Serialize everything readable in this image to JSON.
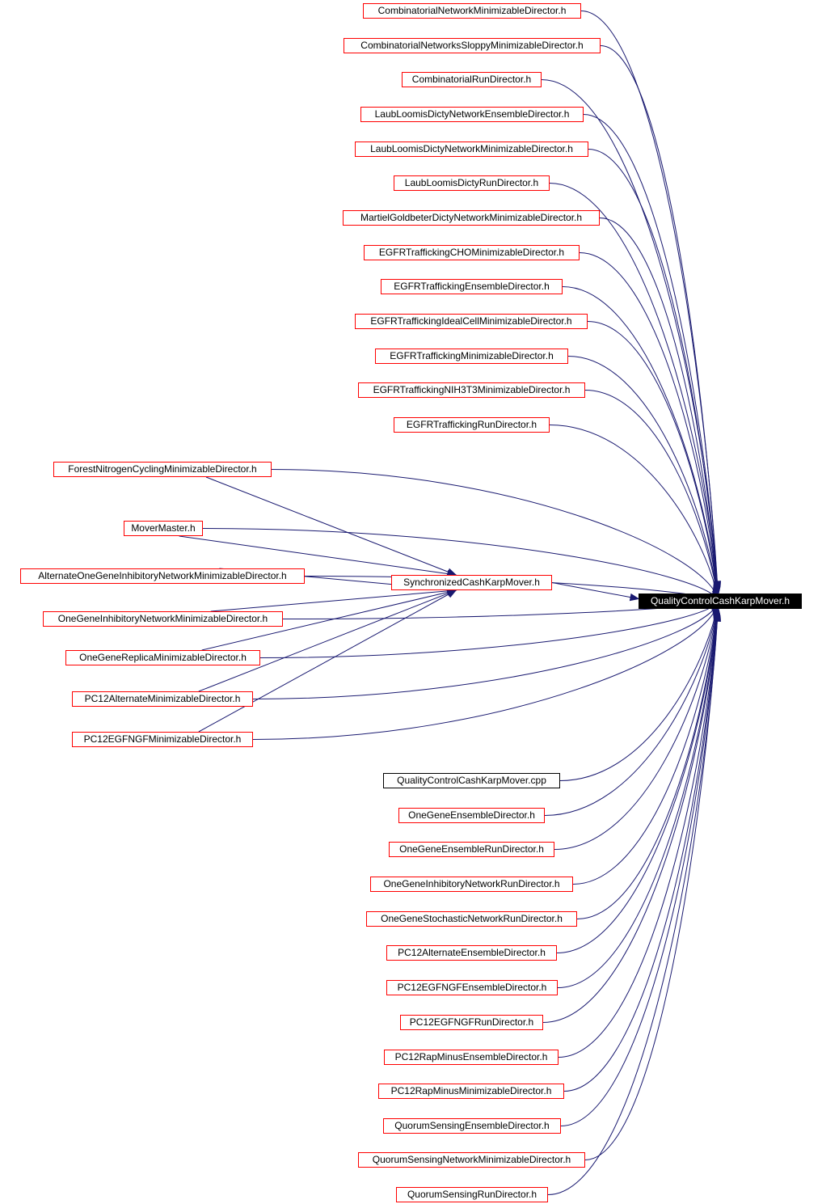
{
  "diagram": {
    "type": "include-dependency-graph",
    "edge_color": "#191970",
    "node_border_color": "#ff0000",
    "target": {
      "id": "target",
      "label": "QualityControlCashKarpMover.h"
    },
    "intermediate": {
      "id": "sync",
      "label": "SynchronizedCashKarpMover.h"
    },
    "nodes": [
      {
        "id": "n1",
        "label": "CombinatorialNetworkMinimizableDirector.h",
        "to": [
          "target"
        ]
      },
      {
        "id": "n2",
        "label": "CombinatorialNetworksSloppyMinimizableDirector.h",
        "to": [
          "target"
        ]
      },
      {
        "id": "n3",
        "label": "CombinatorialRunDirector.h",
        "to": [
          "target"
        ]
      },
      {
        "id": "n4",
        "label": "LaubLoomisDictyNetworkEnsembleDirector.h",
        "to": [
          "target"
        ]
      },
      {
        "id": "n5",
        "label": "LaubLoomisDictyNetworkMinimizableDirector.h",
        "to": [
          "target"
        ]
      },
      {
        "id": "n6",
        "label": "LaubLoomisDictyRunDirector.h",
        "to": [
          "target"
        ]
      },
      {
        "id": "n7",
        "label": "MartielGoldbeterDictyNetworkMinimizableDirector.h",
        "to": [
          "target"
        ]
      },
      {
        "id": "n8",
        "label": "EGFRTraffickingCHOMinimizableDirector.h",
        "to": [
          "target"
        ]
      },
      {
        "id": "n9",
        "label": "EGFRTraffickingEnsembleDirector.h",
        "to": [
          "target"
        ]
      },
      {
        "id": "n10",
        "label": "EGFRTraffickingIdealCellMinimizableDirector.h",
        "to": [
          "target"
        ]
      },
      {
        "id": "n11",
        "label": "EGFRTraffickingMinimizableDirector.h",
        "to": [
          "target"
        ]
      },
      {
        "id": "n12",
        "label": "EGFRTraffickingNIH3T3MinimizableDirector.h",
        "to": [
          "target"
        ]
      },
      {
        "id": "n13",
        "label": "EGFRTraffickingRunDirector.h",
        "to": [
          "target"
        ]
      },
      {
        "id": "n14",
        "label": "ForestNitrogenCyclingMinimizableDirector.h",
        "to": [
          "target",
          "sync"
        ]
      },
      {
        "id": "n15",
        "label": "MoverMaster.h",
        "to": [
          "target",
          "sync"
        ]
      },
      {
        "id": "n16",
        "label": "AlternateOneGeneInhibitoryNetworkMinimizableDirector.h",
        "to": [
          "target",
          "sync"
        ]
      },
      {
        "id": "n17",
        "label": "OneGeneInhibitoryNetworkMinimizableDirector.h",
        "to": [
          "target",
          "sync"
        ]
      },
      {
        "id": "n18",
        "label": "OneGeneReplicaMinimizableDirector.h",
        "to": [
          "target",
          "sync"
        ]
      },
      {
        "id": "n19",
        "label": "PC12AlternateMinimizableDirector.h",
        "to": [
          "target",
          "sync"
        ]
      },
      {
        "id": "n20",
        "label": "PC12EGFNGFMinimizableDirector.h",
        "to": [
          "target",
          "sync"
        ]
      },
      {
        "id": "n21",
        "label": "QualityControlCashKarpMover.cpp",
        "to": [
          "target"
        ],
        "border": "black"
      },
      {
        "id": "n22",
        "label": "OneGeneEnsembleDirector.h",
        "to": [
          "target"
        ]
      },
      {
        "id": "n23",
        "label": "OneGeneEnsembleRunDirector.h",
        "to": [
          "target"
        ]
      },
      {
        "id": "n24",
        "label": "OneGeneInhibitoryNetworkRunDirector.h",
        "to": [
          "target"
        ]
      },
      {
        "id": "n25",
        "label": "OneGeneStochasticNetworkRunDirector.h",
        "to": [
          "target"
        ]
      },
      {
        "id": "n26",
        "label": "PC12AlternateEnsembleDirector.h",
        "to": [
          "target"
        ]
      },
      {
        "id": "n27",
        "label": "PC12EGFNGFEnsembleDirector.h",
        "to": [
          "target"
        ]
      },
      {
        "id": "n28",
        "label": "PC12EGFNGFRunDirector.h",
        "to": [
          "target"
        ]
      },
      {
        "id": "n29",
        "label": "PC12RapMinusEnsembleDirector.h",
        "to": [
          "target"
        ]
      },
      {
        "id": "n30",
        "label": "PC12RapMinusMinimizableDirector.h",
        "to": [
          "target"
        ]
      },
      {
        "id": "n31",
        "label": "QuorumSensingEnsembleDirector.h",
        "to": [
          "target"
        ]
      },
      {
        "id": "n32",
        "label": "QuorumSensingNetworkMinimizableDirector.h",
        "to": [
          "target"
        ]
      },
      {
        "id": "n33",
        "label": "QuorumSensingRunDirector.h",
        "to": [
          "target"
        ]
      }
    ],
    "sync_to": [
      "target"
    ]
  }
}
